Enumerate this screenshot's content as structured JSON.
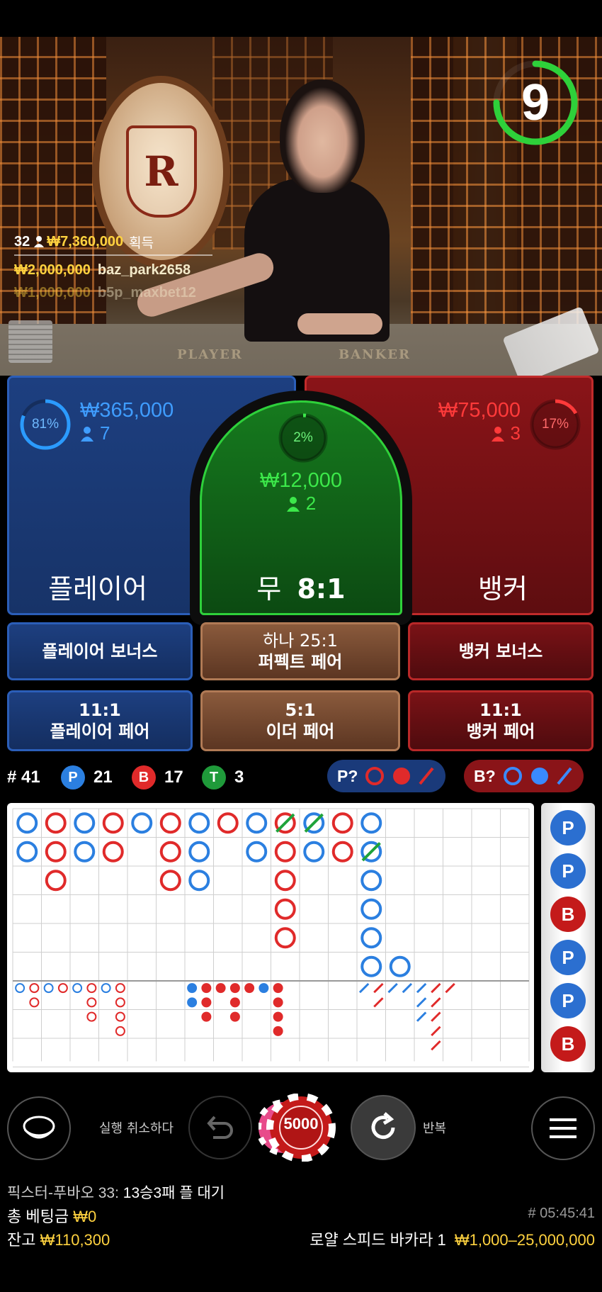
{
  "video": {
    "felt_player": "PLAYER",
    "felt_banker": "BANKER",
    "logo_letter": "R",
    "timer": "9",
    "timer_fraction": 0.75
  },
  "winners": {
    "count": "32",
    "total": "₩7,360,000",
    "total_suffix": "획득",
    "rows": [
      {
        "amount": "₩2,000,000",
        "user": "baz_park2658"
      },
      {
        "amount": "₩1,000,000",
        "user": "b5p_maxbet12"
      }
    ]
  },
  "player": {
    "pct": "81%",
    "pct_value": 0.81,
    "amount": "₩365,000",
    "count": "7",
    "label": "플레이어"
  },
  "tie": {
    "pct": "2%",
    "pct_value": 0.02,
    "amount": "₩12,000",
    "count": "2",
    "label": "무",
    "odds": "8:1"
  },
  "banker": {
    "pct": "17%",
    "pct_value": 0.17,
    "amount": "₩75,000",
    "count": "3",
    "label": "뱅커"
  },
  "side_bets": {
    "player_bonus": "플레이어 보너스",
    "perfect_pair_top": "하나 25:1",
    "perfect_pair": "퍼펙트 페어",
    "banker_bonus": "뱅커 보너스",
    "player_pair_odds": "11:1",
    "player_pair": "플레이어 페어",
    "either_pair_odds": "5:1",
    "either_pair": "이더 페어",
    "banker_pair_odds": "11:1",
    "banker_pair": "뱅커 페어"
  },
  "stats": {
    "round": "# 41",
    "p_letter": "P",
    "p_count": "21",
    "b_letter": "B",
    "b_count": "17",
    "t_letter": "T",
    "t_count": "3",
    "p_predict": "P?",
    "b_predict": "B?"
  },
  "side_road": [
    "P",
    "P",
    "B",
    "P",
    "P",
    "B"
  ],
  "controls": {
    "undo_label": "실행 취소하다",
    "chip_value": "5000",
    "repeat_label": "반복"
  },
  "footer": {
    "streak_label": "픽스터-푸바오 33:",
    "streak_value": "13승3패 플 대기",
    "total_bet_label": "총 베팅금",
    "total_bet_value": "₩0",
    "game_id": "# 05:45:41",
    "balance_label": "잔고",
    "balance_value": "₩110,300",
    "table_name": "로얄 스피드 바카라 1",
    "table_limits": "₩1,000–25,000,000"
  },
  "colors": {
    "player_blue": "#2b7fe0",
    "banker_red": "#e02a2a",
    "tie_green": "#2ed13a",
    "gold": "#ffd23f"
  }
}
